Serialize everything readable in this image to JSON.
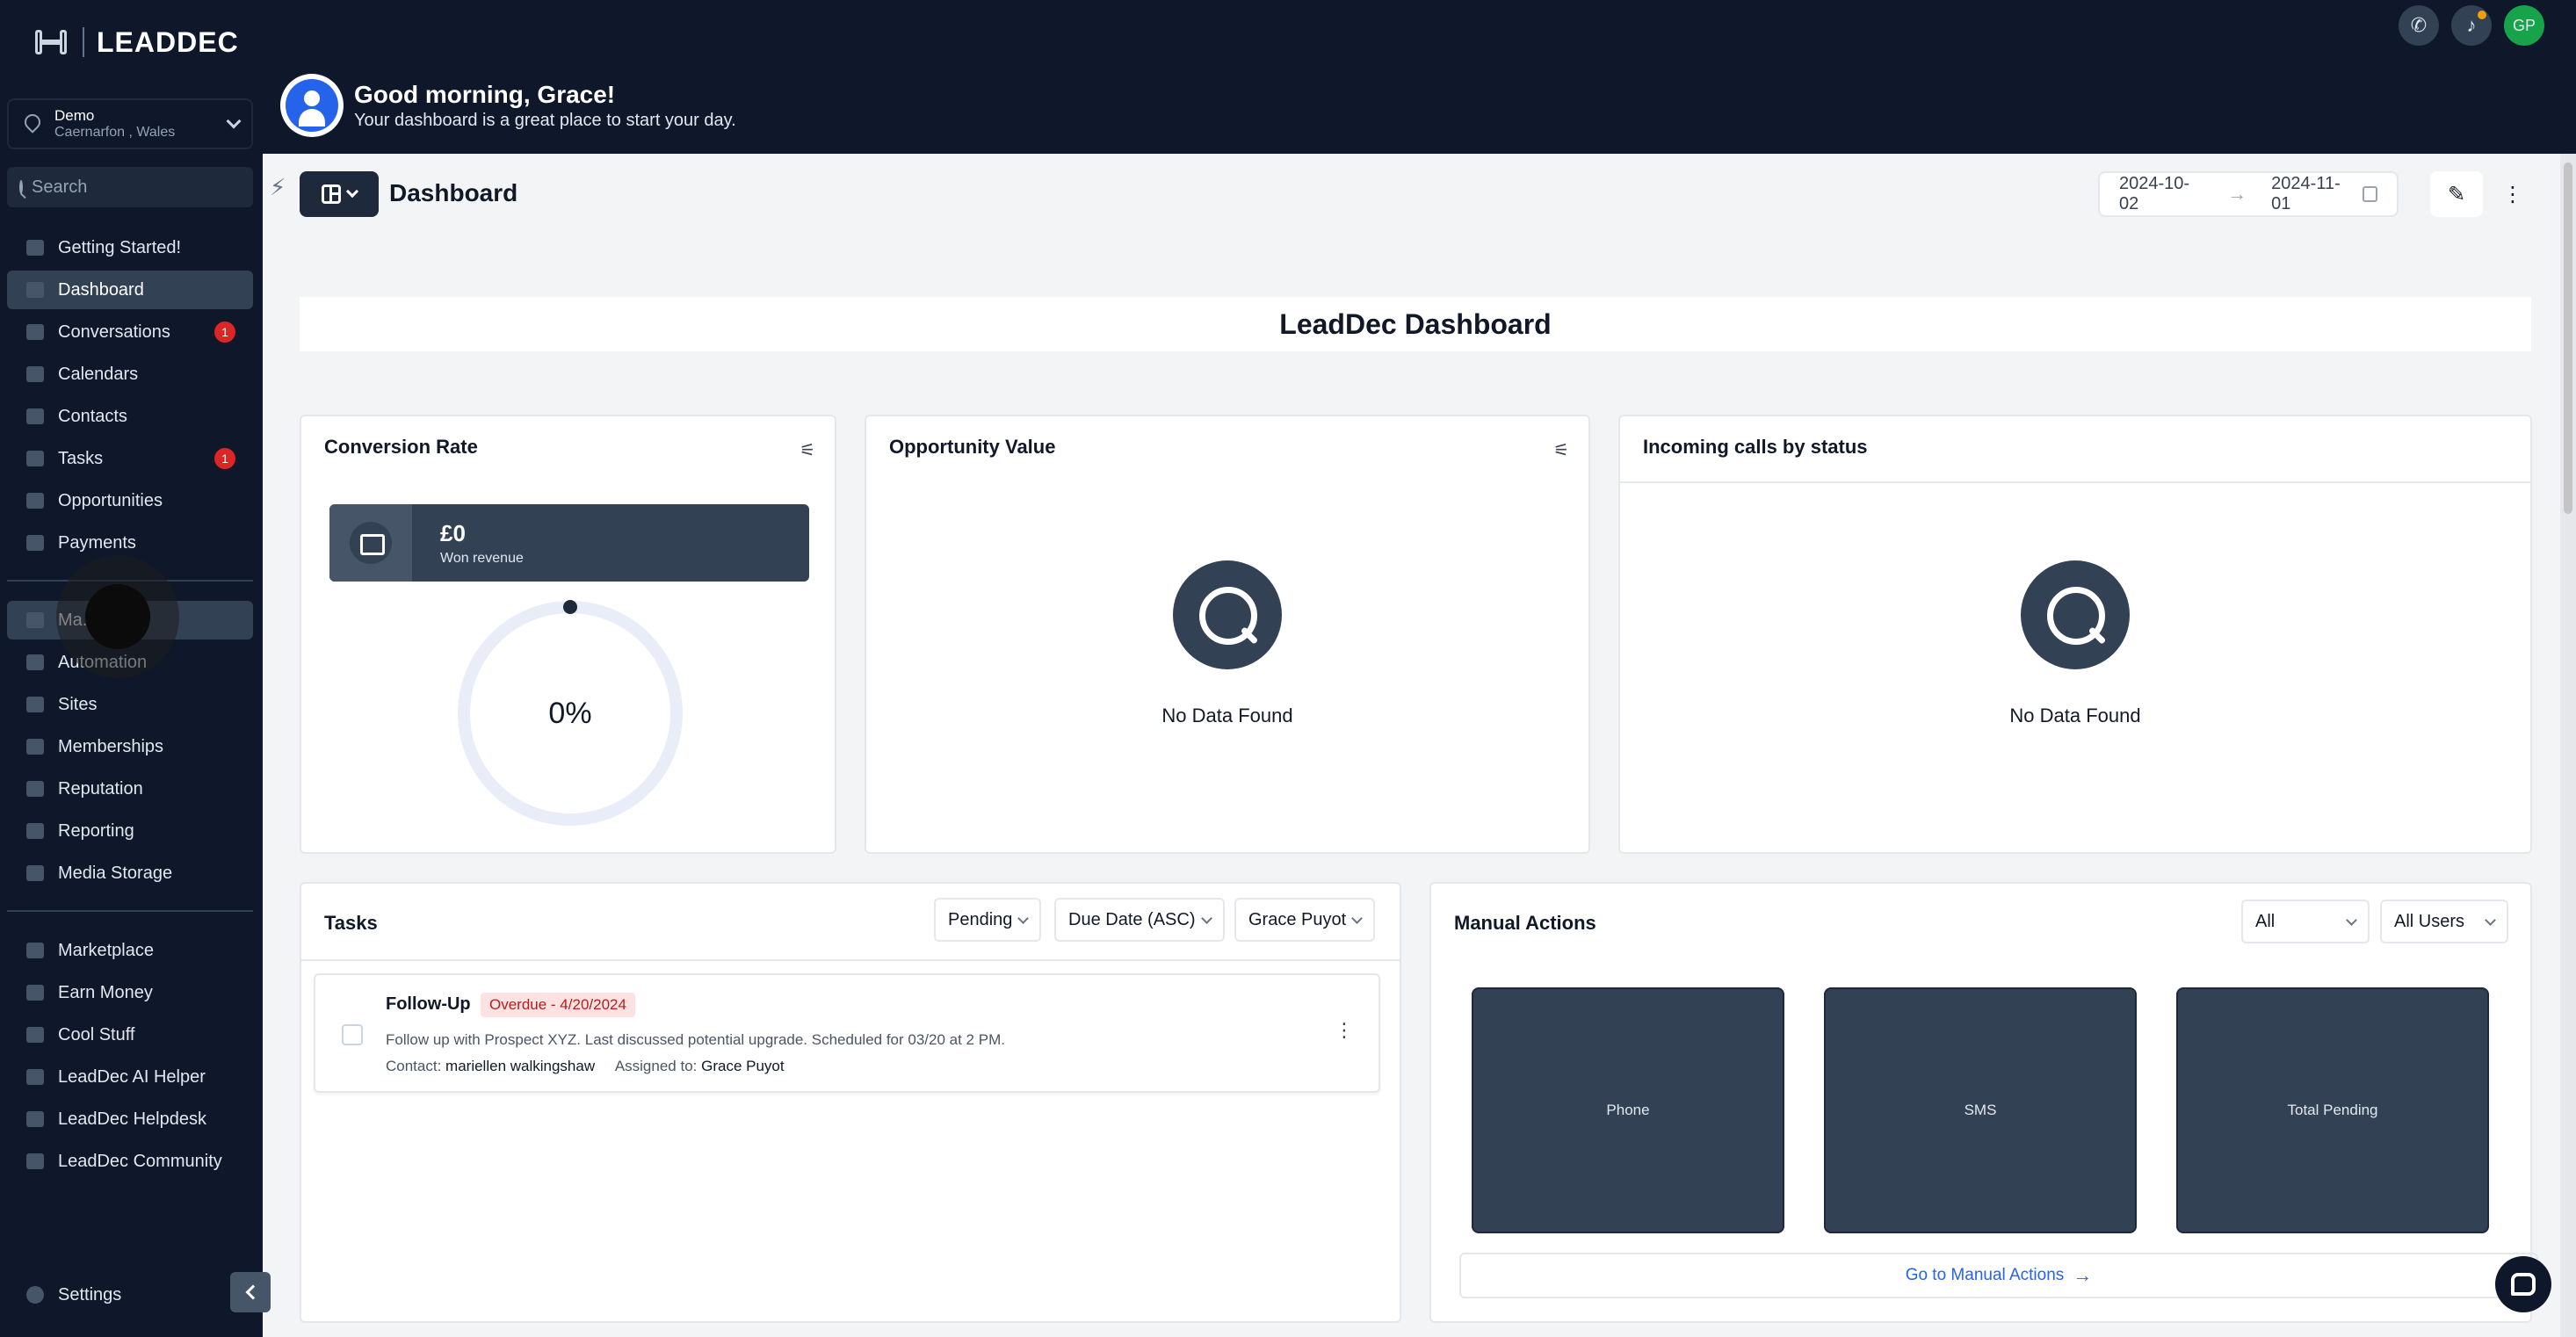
{
  "brand": {
    "name": "LEADDEC"
  },
  "location": {
    "name": "Demo",
    "address": "Caernarfon , Wales"
  },
  "search": {
    "placeholder": "Search"
  },
  "sidebar": {
    "main": [
      {
        "label": "Getting Started!",
        "icon": "flag-icon"
      },
      {
        "label": "Dashboard",
        "icon": "dashboard-icon",
        "active": true
      },
      {
        "label": "Conversations",
        "icon": "chat-icon",
        "badge": "1"
      },
      {
        "label": "Calendars",
        "icon": "calendar-icon"
      },
      {
        "label": "Contacts",
        "icon": "user-icon"
      },
      {
        "label": "Tasks",
        "icon": "check-icon",
        "badge": "1"
      },
      {
        "label": "Opportunities",
        "icon": "funnel-icon"
      },
      {
        "label": "Payments",
        "icon": "card-icon"
      }
    ],
    "marketing": [
      {
        "label": "Ma...",
        "icon": "megaphone-icon"
      },
      {
        "label": "Automation",
        "icon": "automation-icon"
      },
      {
        "label": "Sites",
        "icon": "sites-icon"
      },
      {
        "label": "Memberships",
        "icon": "memberships-icon"
      },
      {
        "label": "Reputation",
        "icon": "star-icon"
      },
      {
        "label": "Reporting",
        "icon": "chart-icon"
      },
      {
        "label": "Media Storage",
        "icon": "image-icon"
      }
    ],
    "extras": [
      {
        "label": "Marketplace",
        "icon": "cart-icon"
      },
      {
        "label": "Earn Money",
        "icon": "money-icon"
      },
      {
        "label": "Cool Stuff",
        "icon": "fire-icon"
      },
      {
        "label": "LeadDec AI Helper",
        "icon": "robot-icon"
      },
      {
        "label": "LeadDec Helpdesk",
        "icon": "info-icon"
      },
      {
        "label": "LeadDec Community",
        "icon": "people-icon"
      }
    ],
    "settings": "Settings"
  },
  "header": {
    "greeting": "Good morning, Grace!",
    "subtitle": "Your dashboard is a great place to start your day.",
    "avatar_initials": "GP"
  },
  "dashboard": {
    "title": "Dashboard",
    "date_from": "2024-10-02",
    "date_to": "2024-11-01",
    "banner": "LeadDec Dashboard"
  },
  "conversion": {
    "title": "Conversion Rate",
    "won_value": "£0",
    "won_label": "Won revenue",
    "rate": "0%",
    "rate_fraction": 0
  },
  "opportunity": {
    "title": "Opportunity Value",
    "empty": "No Data Found"
  },
  "calls": {
    "title": "Incoming calls by status",
    "empty": "No Data Found"
  },
  "tasks": {
    "title": "Tasks",
    "filters": {
      "status": "Pending",
      "sort": "Due Date (ASC)",
      "user": "Grace Puyot"
    },
    "items": [
      {
        "title": "Follow-Up",
        "badge": "Overdue - 4/20/2024",
        "description": "Follow up with Prospect XYZ. Last discussed potential upgrade. Scheduled for 03/20 at 2 PM.",
        "contact_label": "Contact:",
        "contact": "mariellen walkingshaw",
        "assigned_label": "Assigned to:",
        "assigned": "Grace Puyot"
      }
    ]
  },
  "manual_actions": {
    "title": "Manual Actions",
    "filter_type": "All",
    "filter_user": "All Users",
    "tiles": [
      "Phone",
      "SMS",
      "Total Pending"
    ],
    "link": "Go to Manual Actions"
  },
  "colors": {
    "sidebar_bg": "#0f172a",
    "active_item": "#334155",
    "badge": "#dc2626",
    "link": "#2563eb",
    "avatar": "#16a34a"
  }
}
